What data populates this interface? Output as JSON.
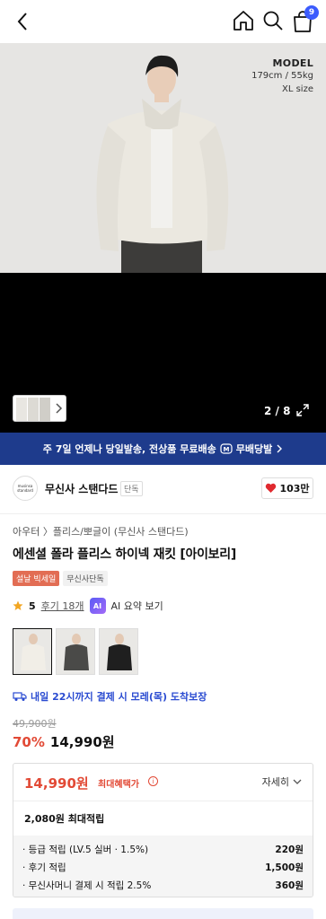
{
  "header": {
    "back_icon": "chevron-left-icon",
    "home_icon": "home-icon",
    "search_icon": "search-icon",
    "cart_icon": "shopping-bag-icon",
    "cart_count": "9"
  },
  "gallery": {
    "model_title": "MODEL",
    "model_height_weight": "179cm / 55kg",
    "model_size": "XL size",
    "counter": "2 / 8"
  },
  "banner": {
    "text": "주 7일 언제나 당일발송, 전상품 무료배송",
    "tag": "무배당발",
    "accent": "#1e3b8c"
  },
  "brand": {
    "logo_text": "musinsa standard",
    "name": "무신사 스탠다드",
    "badge": "단독",
    "likes": "103만"
  },
  "product": {
    "breadcrumb": "아우터 〉플리스/뽀글이 (무신사 스탠다드)",
    "title": "에센셜 폴라 플리스 하이넥 재킷 [아이보리]",
    "tags": [
      "설날 빅세일",
      "무신사단독"
    ],
    "rating": "5",
    "review_label": "후기 18개",
    "ai_badge": "AI",
    "ai_summary": "AI 요약 보기",
    "delivery": "내일 22시까지 결제 시 모레(목) 도착보장",
    "original_price": "49,900원",
    "discount": "70%",
    "price": "14,990원"
  },
  "benefits": {
    "price": "14,990원",
    "max_label": "최대혜택가",
    "detail_label": "자세히",
    "points_total": "2,080원 최대적립",
    "items": [
      {
        "label": "· 등급 적립 (LV.5 실버 · 1.5%)",
        "value": "220원"
      },
      {
        "label": "· 후기 적립",
        "value": "1,500원"
      },
      {
        "label": "· 무신사머니 결제 시 적립 2.5%",
        "value": "360원"
      }
    ]
  },
  "colors": {
    "accent_blue": "#3b5bfd",
    "sale_red": "#e24a36"
  }
}
